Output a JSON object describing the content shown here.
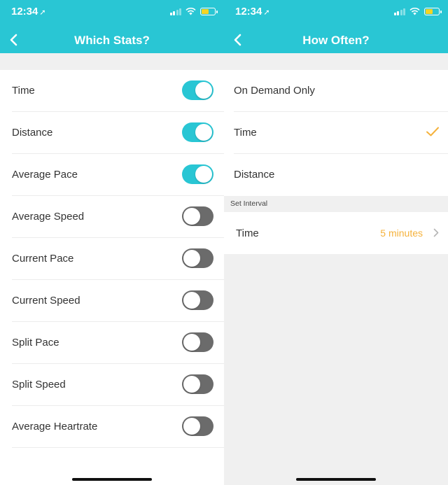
{
  "status_bar": {
    "time": "12:34",
    "location_arrow": "➚"
  },
  "left_screen": {
    "title": "Which Stats?",
    "back_icon": "chevron-left-icon",
    "stats": [
      {
        "label": "Time",
        "enabled": true
      },
      {
        "label": "Distance",
        "enabled": true
      },
      {
        "label": "Average Pace",
        "enabled": true
      },
      {
        "label": "Average Speed",
        "enabled": false
      },
      {
        "label": "Current Pace",
        "enabled": false
      },
      {
        "label": "Current Speed",
        "enabled": false
      },
      {
        "label": "Split Pace",
        "enabled": false
      },
      {
        "label": "Split Speed",
        "enabled": false
      },
      {
        "label": "Average Heartrate",
        "enabled": false
      }
    ]
  },
  "right_screen": {
    "title": "How Often?",
    "back_icon": "chevron-left-icon",
    "options": [
      {
        "label": "On Demand Only",
        "selected": false
      },
      {
        "label": "Time",
        "selected": true
      },
      {
        "label": "Distance",
        "selected": false
      }
    ],
    "section_header": "Set Interval",
    "interval": {
      "label": "Time",
      "value": "5 minutes"
    }
  },
  "colors": {
    "brand": "#29c6d4",
    "toggle_off": "#6b6b6b",
    "accent": "#f5b23c",
    "battery": "#f5d423"
  }
}
